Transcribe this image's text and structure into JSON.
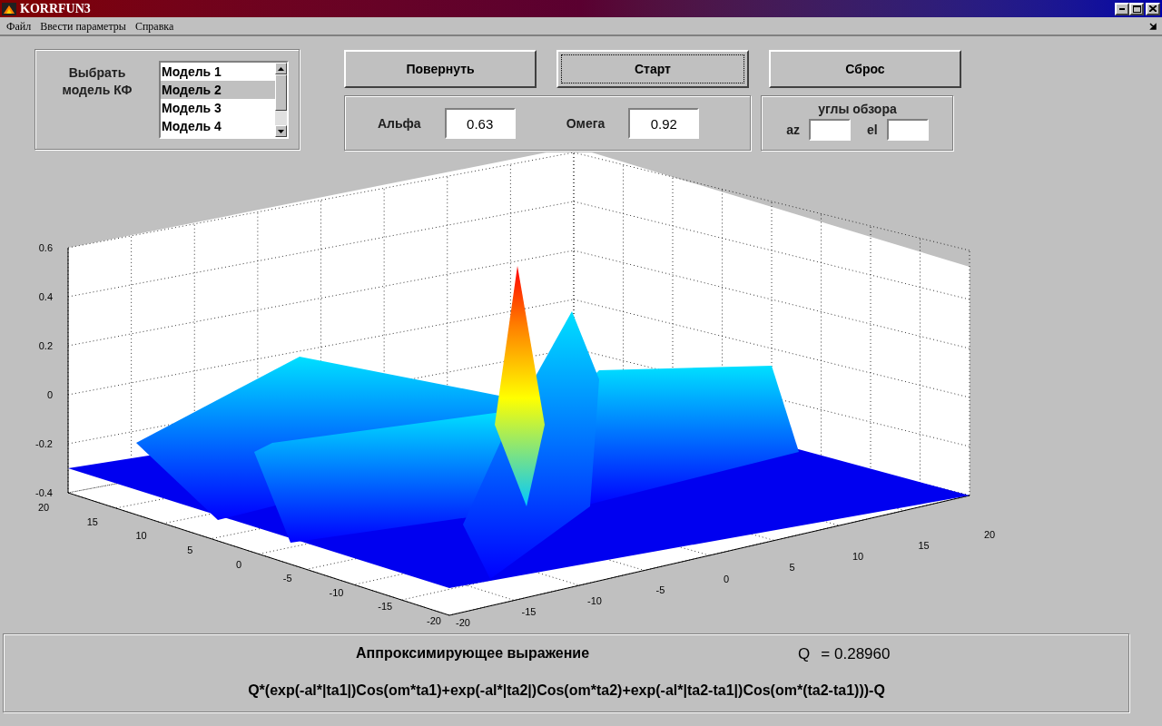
{
  "window": {
    "title": "KORRFUN3"
  },
  "menu": [
    "Файл",
    "Ввести параметры",
    "Справка"
  ],
  "model_panel": {
    "label": "Выбрать модель КФ",
    "items": [
      {
        "label": "Модель 1",
        "selected": false
      },
      {
        "label": "Модель 2",
        "selected": true
      },
      {
        "label": "Модель 3",
        "selected": false
      },
      {
        "label": "Модель 4",
        "selected": false
      }
    ]
  },
  "buttons": [
    {
      "label": "Повернуть",
      "focused": false
    },
    {
      "label": "Старт",
      "focused": true
    },
    {
      "label": "Сброс",
      "focused": false
    }
  ],
  "params": [
    {
      "label": "Альфа",
      "value": "0.63"
    },
    {
      "label": "Омега",
      "value": "0.92"
    }
  ],
  "view_angles": {
    "title": "углы обзора",
    "fields": [
      {
        "label": "az"
      },
      {
        "label": "el"
      }
    ]
  },
  "plot": {
    "z_ticks": [
      "0.6",
      "0.4",
      "0.2",
      "0",
      "-0.2",
      "-0.4"
    ],
    "x_ticks": [
      "-20",
      "-15",
      "-10",
      "-5",
      "0",
      "5",
      "10",
      "15",
      "20"
    ],
    "y_ticks": [
      "20",
      "15",
      "10",
      "5",
      "0",
      "-5",
      "-10",
      "-15",
      "-20"
    ]
  },
  "formula_panel": {
    "title": "Аппроксимирующее выражение",
    "q_label": "Q",
    "q_value": "=  0.28960",
    "expression": "Q*(exp(-al*|ta1|)Cos(om*ta1)+exp(-al*|ta2|)Cos(om*ta2)+exp(-al*|ta2-ta1|)Cos(om*(ta2-ta1)))-Q"
  }
}
